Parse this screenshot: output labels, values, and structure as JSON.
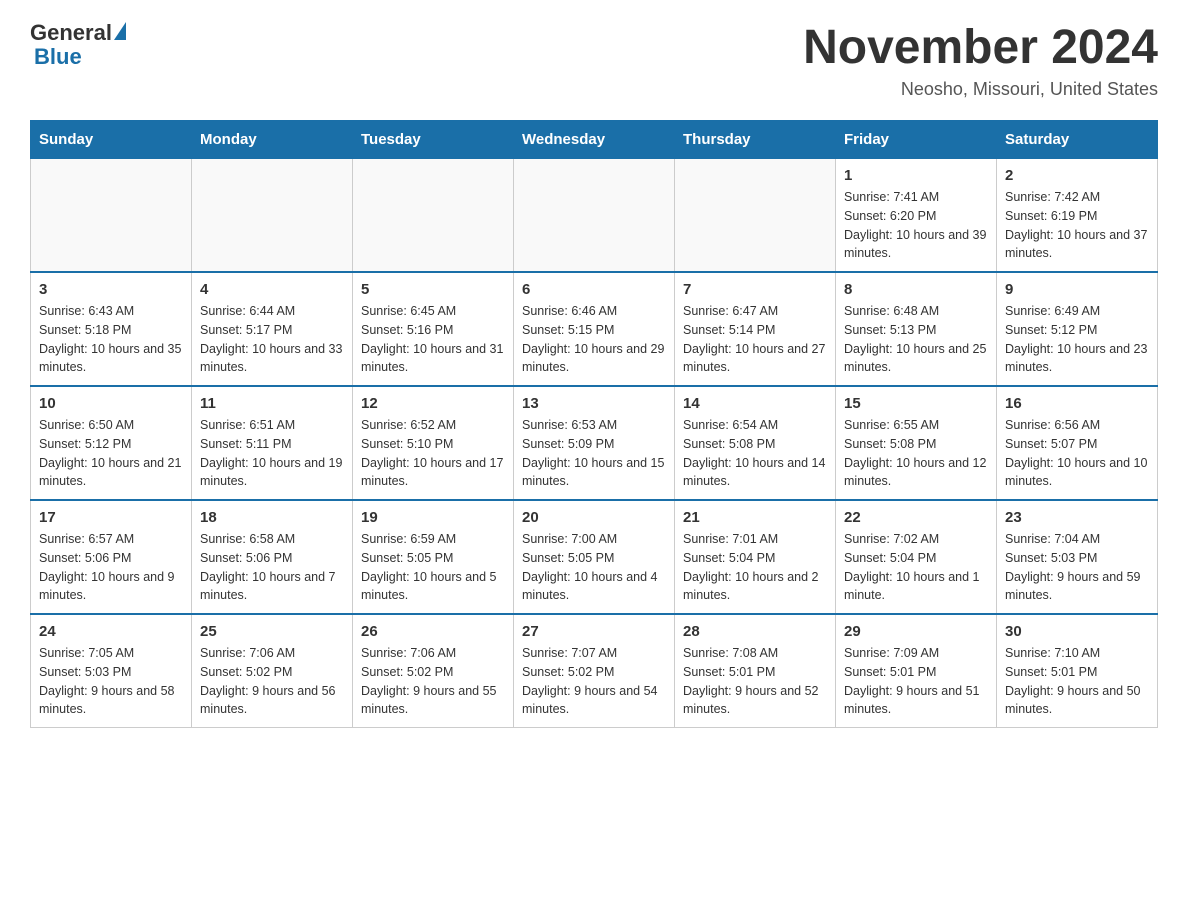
{
  "header": {
    "logo": {
      "general": "General",
      "blue": "Blue"
    },
    "title": "November 2024",
    "location": "Neosho, Missouri, United States"
  },
  "calendar": {
    "days_of_week": [
      "Sunday",
      "Monday",
      "Tuesday",
      "Wednesday",
      "Thursday",
      "Friday",
      "Saturday"
    ],
    "weeks": [
      [
        {
          "day": "",
          "info": ""
        },
        {
          "day": "",
          "info": ""
        },
        {
          "day": "",
          "info": ""
        },
        {
          "day": "",
          "info": ""
        },
        {
          "day": "",
          "info": ""
        },
        {
          "day": "1",
          "info": "Sunrise: 7:41 AM\nSunset: 6:20 PM\nDaylight: 10 hours and 39 minutes."
        },
        {
          "day": "2",
          "info": "Sunrise: 7:42 AM\nSunset: 6:19 PM\nDaylight: 10 hours and 37 minutes."
        }
      ],
      [
        {
          "day": "3",
          "info": "Sunrise: 6:43 AM\nSunset: 5:18 PM\nDaylight: 10 hours and 35 minutes."
        },
        {
          "day": "4",
          "info": "Sunrise: 6:44 AM\nSunset: 5:17 PM\nDaylight: 10 hours and 33 minutes."
        },
        {
          "day": "5",
          "info": "Sunrise: 6:45 AM\nSunset: 5:16 PM\nDaylight: 10 hours and 31 minutes."
        },
        {
          "day": "6",
          "info": "Sunrise: 6:46 AM\nSunset: 5:15 PM\nDaylight: 10 hours and 29 minutes."
        },
        {
          "day": "7",
          "info": "Sunrise: 6:47 AM\nSunset: 5:14 PM\nDaylight: 10 hours and 27 minutes."
        },
        {
          "day": "8",
          "info": "Sunrise: 6:48 AM\nSunset: 5:13 PM\nDaylight: 10 hours and 25 minutes."
        },
        {
          "day": "9",
          "info": "Sunrise: 6:49 AM\nSunset: 5:12 PM\nDaylight: 10 hours and 23 minutes."
        }
      ],
      [
        {
          "day": "10",
          "info": "Sunrise: 6:50 AM\nSunset: 5:12 PM\nDaylight: 10 hours and 21 minutes."
        },
        {
          "day": "11",
          "info": "Sunrise: 6:51 AM\nSunset: 5:11 PM\nDaylight: 10 hours and 19 minutes."
        },
        {
          "day": "12",
          "info": "Sunrise: 6:52 AM\nSunset: 5:10 PM\nDaylight: 10 hours and 17 minutes."
        },
        {
          "day": "13",
          "info": "Sunrise: 6:53 AM\nSunset: 5:09 PM\nDaylight: 10 hours and 15 minutes."
        },
        {
          "day": "14",
          "info": "Sunrise: 6:54 AM\nSunset: 5:08 PM\nDaylight: 10 hours and 14 minutes."
        },
        {
          "day": "15",
          "info": "Sunrise: 6:55 AM\nSunset: 5:08 PM\nDaylight: 10 hours and 12 minutes."
        },
        {
          "day": "16",
          "info": "Sunrise: 6:56 AM\nSunset: 5:07 PM\nDaylight: 10 hours and 10 minutes."
        }
      ],
      [
        {
          "day": "17",
          "info": "Sunrise: 6:57 AM\nSunset: 5:06 PM\nDaylight: 10 hours and 9 minutes."
        },
        {
          "day": "18",
          "info": "Sunrise: 6:58 AM\nSunset: 5:06 PM\nDaylight: 10 hours and 7 minutes."
        },
        {
          "day": "19",
          "info": "Sunrise: 6:59 AM\nSunset: 5:05 PM\nDaylight: 10 hours and 5 minutes."
        },
        {
          "day": "20",
          "info": "Sunrise: 7:00 AM\nSunset: 5:05 PM\nDaylight: 10 hours and 4 minutes."
        },
        {
          "day": "21",
          "info": "Sunrise: 7:01 AM\nSunset: 5:04 PM\nDaylight: 10 hours and 2 minutes."
        },
        {
          "day": "22",
          "info": "Sunrise: 7:02 AM\nSunset: 5:04 PM\nDaylight: 10 hours and 1 minute."
        },
        {
          "day": "23",
          "info": "Sunrise: 7:04 AM\nSunset: 5:03 PM\nDaylight: 9 hours and 59 minutes."
        }
      ],
      [
        {
          "day": "24",
          "info": "Sunrise: 7:05 AM\nSunset: 5:03 PM\nDaylight: 9 hours and 58 minutes."
        },
        {
          "day": "25",
          "info": "Sunrise: 7:06 AM\nSunset: 5:02 PM\nDaylight: 9 hours and 56 minutes."
        },
        {
          "day": "26",
          "info": "Sunrise: 7:06 AM\nSunset: 5:02 PM\nDaylight: 9 hours and 55 minutes."
        },
        {
          "day": "27",
          "info": "Sunrise: 7:07 AM\nSunset: 5:02 PM\nDaylight: 9 hours and 54 minutes."
        },
        {
          "day": "28",
          "info": "Sunrise: 7:08 AM\nSunset: 5:01 PM\nDaylight: 9 hours and 52 minutes."
        },
        {
          "day": "29",
          "info": "Sunrise: 7:09 AM\nSunset: 5:01 PM\nDaylight: 9 hours and 51 minutes."
        },
        {
          "day": "30",
          "info": "Sunrise: 7:10 AM\nSunset: 5:01 PM\nDaylight: 9 hours and 50 minutes."
        }
      ]
    ]
  }
}
